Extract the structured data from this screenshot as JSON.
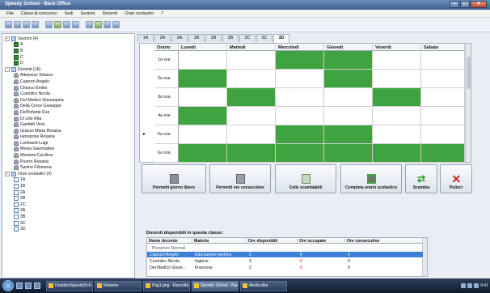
{
  "window": {
    "title": "Speedy School - Back Office"
  },
  "menu": [
    "File",
    "Classi di concorso",
    "Sedi",
    "Sezioni",
    "Docenti",
    "Orari scolastici",
    "?"
  ],
  "toolbar_icons": [
    "new-icon",
    "open-icon",
    "save-icon",
    "print-icon",
    "grid-icon",
    "calendar-icon",
    "users-icon",
    "settings-icon",
    "report-icon",
    "export-icon",
    "import-icon",
    "help-icon"
  ],
  "tree": {
    "sezioni": {
      "label": "Sezioni (4)",
      "items": [
        "A",
        "B",
        "C",
        "D"
      ]
    },
    "docenti": {
      "label": "Docenti (16)",
      "items": [
        "Albanese Silvana",
        "Capozzi Angelo",
        "Chiurco Emilio",
        "Cuomitro Nicola",
        "Del Medico Giuseppina",
        "Della Croce Giuseppe",
        "Dell'Infante Eva",
        "Di Lillo Rita",
        "Gambitt Vera",
        "Grasso Maria Rosaria",
        "Iannarone Rosaria",
        "Lombardi Luigi",
        "Meola Gianmatteo",
        "Messina Carolina",
        "Puorro Rosaria",
        "Savino Filomena"
      ]
    },
    "orari": {
      "label": "Orari scolastici (9)",
      "items": [
        "1A",
        "1B",
        "2A",
        "2B",
        "2C",
        "3A",
        "3B",
        "3C",
        "3D"
      ]
    }
  },
  "tabs": [
    "1A",
    "2A",
    "3A",
    "1B",
    "2B",
    "3B",
    "2C",
    "3C",
    "3D"
  ],
  "active_tab": "3D",
  "schedule": {
    "columns": [
      "Orario",
      "Lunedì",
      "Martedì",
      "Mercoledì",
      "Giovedì",
      "Venerdì",
      "Sabato"
    ],
    "hours": [
      "1a ora",
      "2a ora",
      "3a ora",
      "4a ora",
      "5a ora",
      "6a ora"
    ],
    "current_row_marker": "▸",
    "filled": [
      [
        false,
        false,
        true,
        true,
        false,
        false
      ],
      [
        true,
        false,
        false,
        true,
        false,
        false
      ],
      [
        false,
        true,
        false,
        false,
        true,
        false
      ],
      [
        true,
        false,
        false,
        false,
        false,
        false
      ],
      [
        false,
        false,
        true,
        true,
        false,
        false
      ],
      [
        true,
        true,
        true,
        true,
        true,
        true
      ]
    ],
    "fill_color": "#3fa33f"
  },
  "actions": {
    "permetti_giorno_libero": "Permetti giorno libero",
    "permetti_ore_consecutive": "Permetti ore consecutive",
    "celle_scambiabili": "Celle scambiabili",
    "completa_orario": "Completa orario scolastico",
    "scambia": "Scambia",
    "pulisci": "Pulisci"
  },
  "docenti_panel": {
    "label": "Docenti disponibili in questa classe:",
    "columns": [
      "Nome docente",
      "Materia",
      "Ore disponibili",
      "Ore occupate",
      "Ore consecutive"
    ],
    "group": "Presenze Normali",
    "rows": [
      {
        "name": "Capozzi Angelo",
        "subject": "Educazione tecnica",
        "available": "2",
        "occupied": "0",
        "consecutive": "0",
        "selected": true
      },
      {
        "name": "Cuomitro Nicola",
        "subject": "Inglese",
        "available": "3",
        "occupied": "0",
        "consecutive": "0",
        "selected": false
      },
      {
        "name": "Del Medico Giuse...",
        "subject": "Francese",
        "available": "2",
        "occupied": "0",
        "consecutive": "0",
        "selected": false
      }
    ]
  },
  "taskbar": {
    "tasks": [
      "DropboxSpeedySch...",
      "Release",
      "Pag1.png - Raccolta...",
      "Speedy School - Bac...",
      "Media dba"
    ],
    "active_task_index": 3,
    "clock": "9:41"
  }
}
